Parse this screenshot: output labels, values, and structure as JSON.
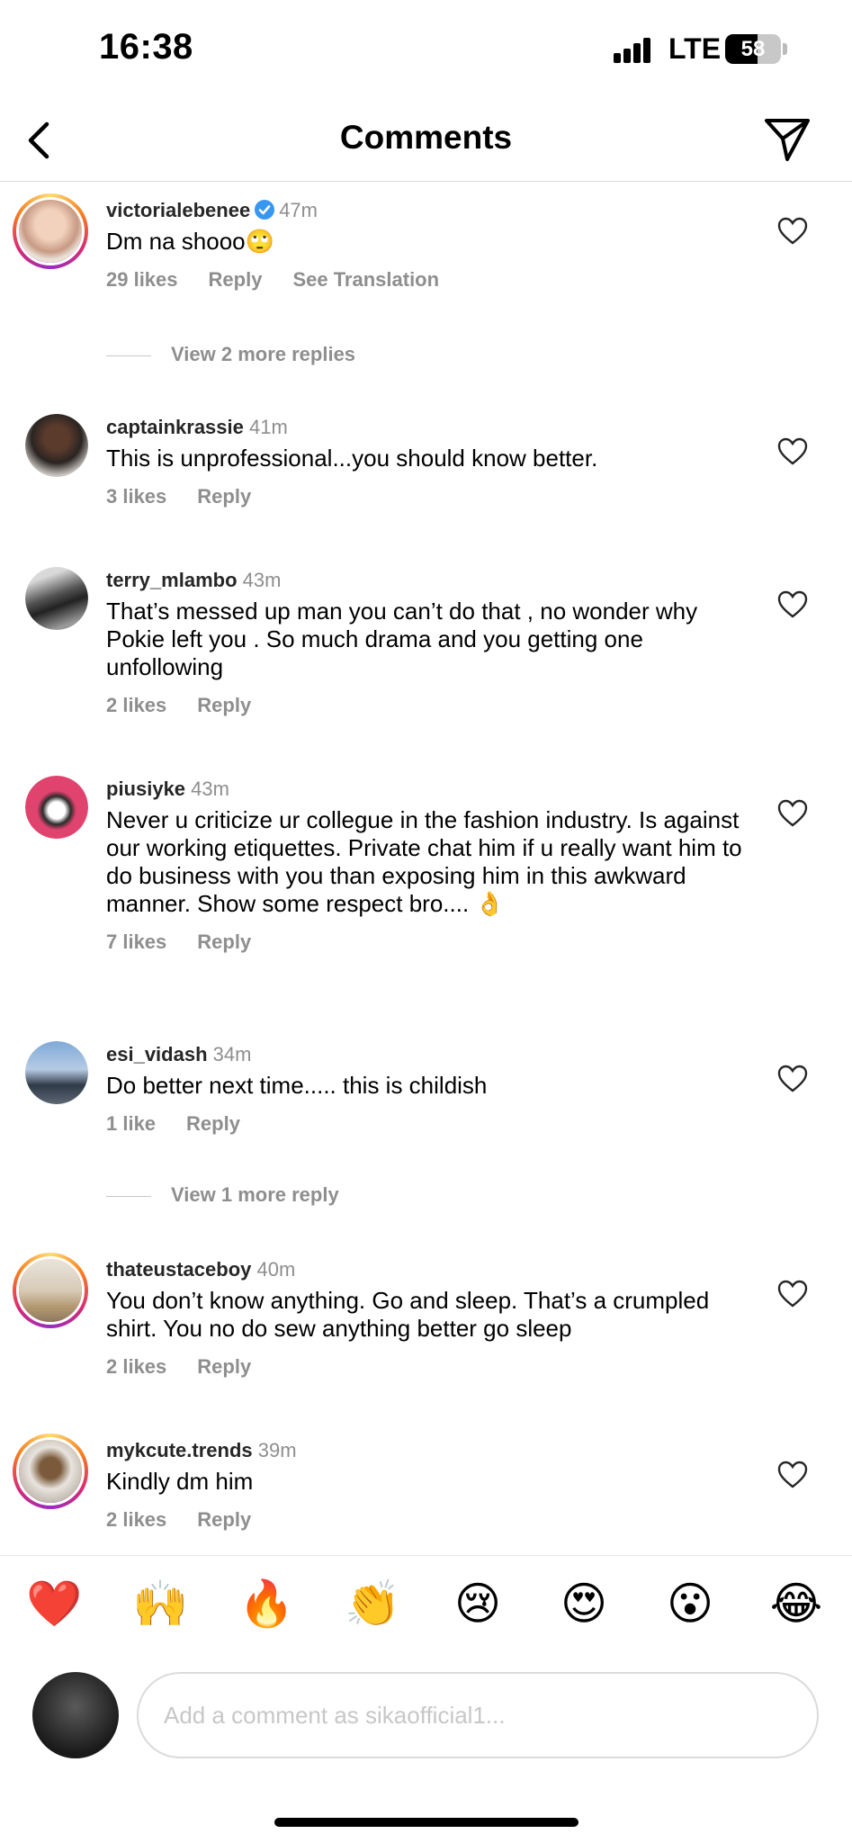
{
  "status_bar": {
    "time": "16:38",
    "network": "LTE",
    "battery": "58"
  },
  "header": {
    "title": "Comments",
    "back_icon": "chevron-left-icon",
    "send_icon": "paper-plane-icon"
  },
  "comments": [
    {
      "username": "victorialebenee",
      "verified": true,
      "time": "47m",
      "text": "Dm na shooo🙄",
      "likes": "29 likes",
      "reply": "Reply",
      "translation": "See Translation",
      "view_more": "View 2 more replies",
      "story_ring": true
    },
    {
      "username": "captainkrassie",
      "time": "41m",
      "text": "This is unprofessional...you should know better.",
      "likes": "3 likes",
      "reply": "Reply"
    },
    {
      "username": "terry_mlambo",
      "time": "43m",
      "text": "That’s messed up man you can’t do that , no wonder why Pokie left you . So much drama and you getting one unfollowing",
      "likes": "2 likes",
      "reply": "Reply"
    },
    {
      "username": "piusiyke",
      "time": "43m",
      "text": "Never u criticize ur collegue in the fashion industry. Is against our working etiquettes. Private chat him if u really want him to do business with you than exposing him in this awkward manner.  Show some respect bro.... 👌",
      "likes": "7 likes",
      "reply": "Reply"
    },
    {
      "username": "esi_vidash",
      "time": "34m",
      "text": "Do better next time..... this is childish",
      "likes": "1 like",
      "reply": "Reply",
      "view_more": "View 1 more reply"
    },
    {
      "username": "thateustaceboy",
      "time": "40m",
      "text": "You don’t know anything. Go and sleep. That’s a crumpled shirt. You no do sew anything better go sleep",
      "likes": "2 likes",
      "reply": "Reply",
      "story_ring": true
    },
    {
      "username": "mykcute.trends",
      "time": "39m",
      "text": "Kindly dm him",
      "likes": "2 likes",
      "reply": "Reply",
      "story_ring": true
    }
  ],
  "reactions": [
    "❤️",
    "🙌",
    "🔥",
    "👏",
    "😢",
    "😍",
    "😮",
    "😂"
  ],
  "composer": {
    "placeholder": "Add a comment as sikaofficial1..."
  }
}
